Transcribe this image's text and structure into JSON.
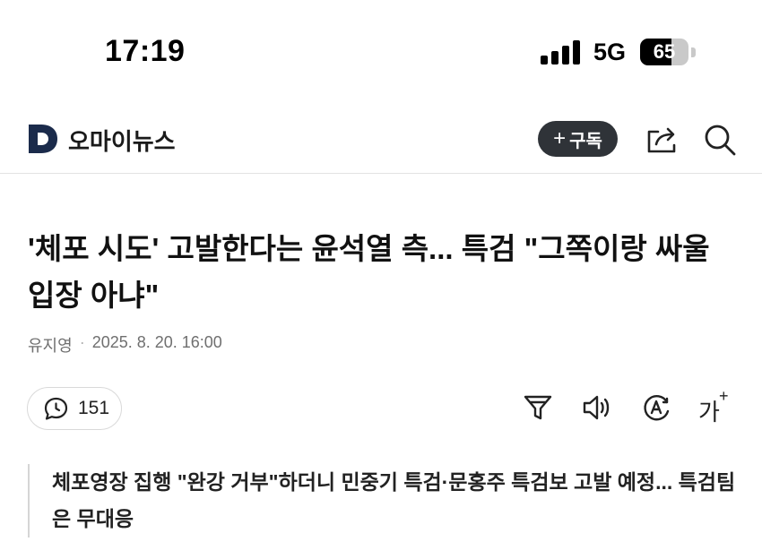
{
  "status_bar": {
    "time": "17:19",
    "network": "5G",
    "battery": "65",
    "battery_level": 0.65
  },
  "header": {
    "logo_letter": "D",
    "brand": "오마이뉴스",
    "subscribe_plus": "+",
    "subscribe_label": "구독",
    "icons": [
      "logo-icon",
      "share-icon",
      "search-icon"
    ]
  },
  "article": {
    "title": "'체포 시도' 고발한다는 윤석열 측... 특검 \"그쪽이랑 싸울 입장 아냐\"",
    "author": "유지영",
    "separator": "·",
    "datetime": "2025. 8. 20. 16:00",
    "comment_count": "151",
    "toolbar_icons": [
      "filter-icon",
      "speaker-icon",
      "translate-icon",
      "font-size-icon"
    ],
    "font_size_label": "가",
    "font_size_plus": "+",
    "summary": "체포영장 집행 \"완강 거부\"하더니 민중기 특검·문홍주 특검보 고발 예정... 특검팀은 무대응"
  },
  "colors": {
    "subscribe_bg": "#2f3338",
    "logo": "#1b2b4b",
    "meta_text": "#6f6f6f"
  }
}
